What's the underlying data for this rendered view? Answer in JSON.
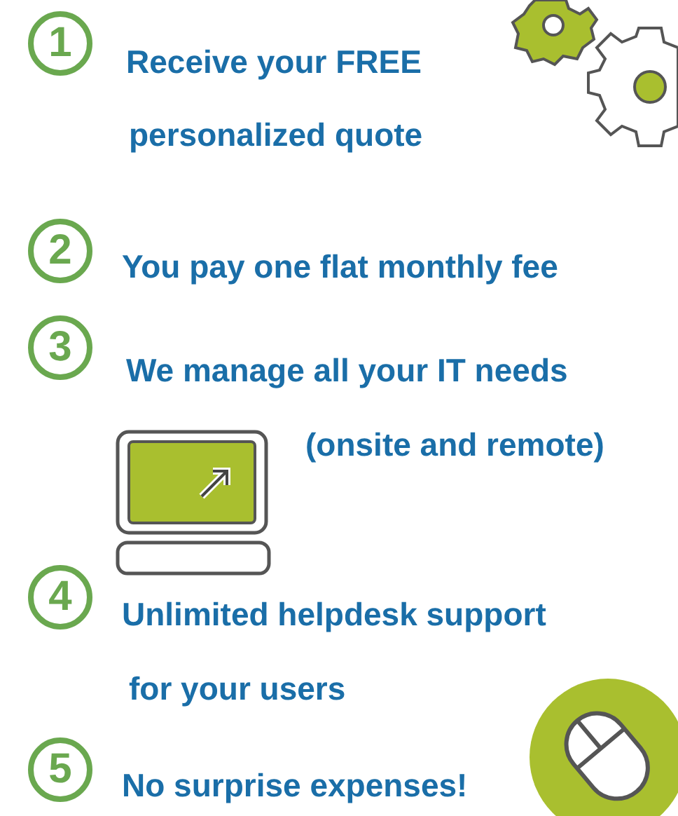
{
  "steps": [
    {
      "number": "1",
      "lines": [
        "Receive your FREE",
        "personalized quote"
      ]
    },
    {
      "number": "2",
      "lines": [
        "You pay one flat monthly fee"
      ]
    },
    {
      "number": "3",
      "lines": [
        "We manage all your IT needs",
        "(onsite and remote)"
      ]
    },
    {
      "number": "4",
      "lines": [
        "Unlimited helpdesk support",
        "for your users"
      ]
    },
    {
      "number": "5",
      "lines": [
        "No surprise expenses!"
      ]
    }
  ]
}
